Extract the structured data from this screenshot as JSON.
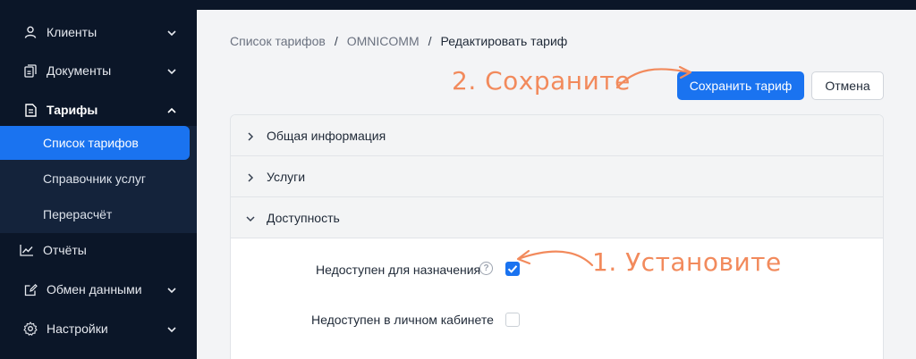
{
  "sidebar": {
    "items": [
      {
        "label": "Клиенты",
        "icon": "user-icon"
      },
      {
        "label": "Документы",
        "icon": "documents-icon"
      },
      {
        "label": "Тарифы",
        "icon": "tariff-icon"
      },
      {
        "label": "Отчёты",
        "icon": "chart-icon"
      },
      {
        "label": "Обмен данными",
        "icon": "edit-icon"
      },
      {
        "label": "Настройки",
        "icon": "gear-icon"
      }
    ],
    "submenu": [
      {
        "label": "Список тарифов"
      },
      {
        "label": "Справочник услуг"
      },
      {
        "label": "Перерасчёт"
      }
    ]
  },
  "breadcrumb": {
    "items": [
      "Список тарифов",
      "OMNICOMM",
      "Редактировать тариф"
    ],
    "separator": "/"
  },
  "toolbar": {
    "save_label": "Сохранить тариф",
    "cancel_label": "Отмена"
  },
  "annotations": {
    "save": "2. Сохраните",
    "set": "1. Установите"
  },
  "accordion": {
    "sections": [
      {
        "label": "Общая информация",
        "expanded": false
      },
      {
        "label": "Услуги",
        "expanded": false
      },
      {
        "label": "Доступность",
        "expanded": true
      }
    ]
  },
  "availability": {
    "unavailable_assign_label": "Недоступен для назначения",
    "unavailable_assign_checked": true,
    "unavailable_cabinet_label": "Недоступен в личном кабинете",
    "unavailable_cabinet_checked": false,
    "help_glyph": "?"
  },
  "colors": {
    "sidebar_bg": "#0b1628",
    "submenu_bg": "#14233b",
    "accent": "#1a73f0",
    "annotation": "#f28a5c"
  }
}
